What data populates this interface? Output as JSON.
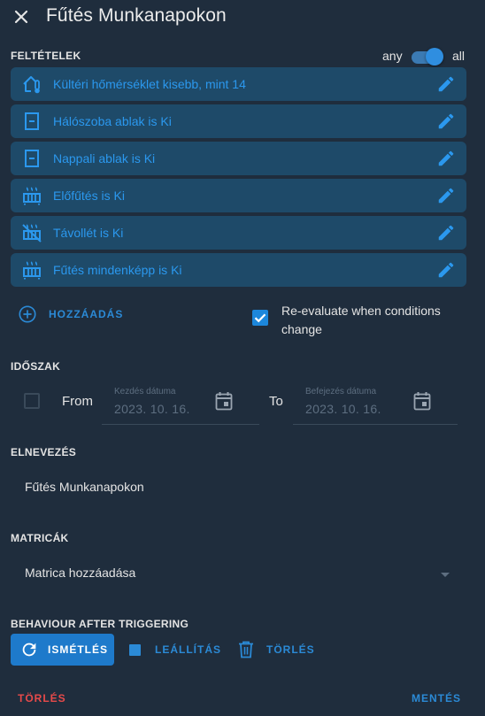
{
  "header": {
    "title": "Fűtés Munkanapokon",
    "close_icon": "close-icon"
  },
  "conditions_section": {
    "label": "FELTÉTELEK",
    "any_label": "any",
    "all_label": "all",
    "match_mode": "all",
    "items": [
      {
        "icon": "home-thermometer-icon",
        "label": "Kültéri hőmérséklet kisebb, mint 14"
      },
      {
        "icon": "window-closed-icon",
        "label": "Hálószoba ablak is Ki"
      },
      {
        "icon": "window-closed-icon",
        "label": "Nappali ablak is Ki"
      },
      {
        "icon": "radiator-icon",
        "label": "Előfűtés is Ki"
      },
      {
        "icon": "radiator-disabled-icon",
        "label": "Távollét is Ki"
      },
      {
        "icon": "radiator-icon",
        "label": "Fűtés mindenképp is Ki"
      }
    ],
    "add_label": "HOZZÁADÁS",
    "reevaluate_label": "Re-evaluate when conditions change",
    "reevaluate_checked": true
  },
  "period_section": {
    "label": "IDŐSZAK",
    "from_label": "From",
    "to_label": "To",
    "from_checked": false,
    "start_placeholder": "Kezdés dátuma",
    "start_value": "2023. 10. 16.",
    "end_placeholder": "Befejezés dátuma",
    "end_value": "2023. 10. 16."
  },
  "name_section": {
    "label": "ELNEVEZÉS",
    "value": "Fűtés Munkanapokon"
  },
  "tags_section": {
    "label": "MATRICÁK",
    "value": "Matrica hozzáadása"
  },
  "behaviour_section": {
    "label": "BEHAVIOUR AFTER TRIGGERING",
    "repeat_label": "ISMÉTLÉS",
    "stop_label": "LEÁLLÍTÁS",
    "delete_label": "TÖRLÉS"
  },
  "footer": {
    "delete_label": "TÖRLÉS",
    "save_label": "MENTÉS"
  },
  "colors": {
    "background": "#1f2d3d",
    "card": "#1e4a69",
    "accent": "#2b8ad6",
    "danger": "#e84a4a"
  }
}
